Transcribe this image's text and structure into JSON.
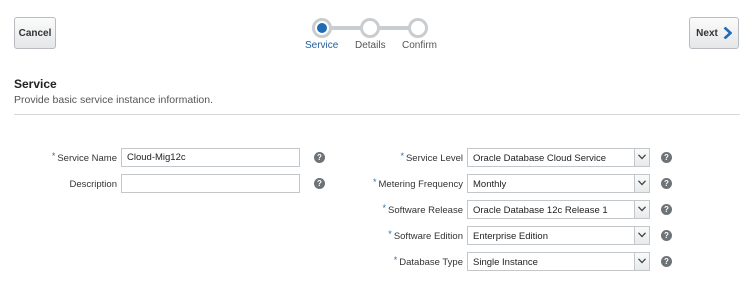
{
  "header": {
    "cancel_label": "Cancel",
    "next_label": "Next"
  },
  "train": {
    "steps": [
      {
        "label": "Service",
        "state": "current"
      },
      {
        "label": "Details",
        "state": "upcoming"
      },
      {
        "label": "Confirm",
        "state": "upcoming"
      }
    ],
    "accent_color": "#1f6bb5"
  },
  "section": {
    "title": "Service",
    "subtitle": "Provide basic service instance information."
  },
  "form": {
    "left": {
      "service_name": {
        "label": "Service Name",
        "required": true,
        "value": "Cloud-Mig12c"
      },
      "description": {
        "label": "Description",
        "required": false,
        "value": ""
      }
    },
    "right": {
      "service_level": {
        "label": "Service Level",
        "required": true,
        "value": "Oracle Database Cloud Service"
      },
      "metering_frequency": {
        "label": "Metering Frequency",
        "required": true,
        "value": "Monthly"
      },
      "software_release": {
        "label": "Software Release",
        "required": true,
        "value": "Oracle Database 12c Release 1"
      },
      "software_edition": {
        "label": "Software Edition",
        "required": true,
        "value": "Enterprise Edition"
      },
      "database_type": {
        "label": "Database Type",
        "required": true,
        "value": "Single Instance"
      }
    },
    "required_marker": "*",
    "help_glyph": "?"
  }
}
